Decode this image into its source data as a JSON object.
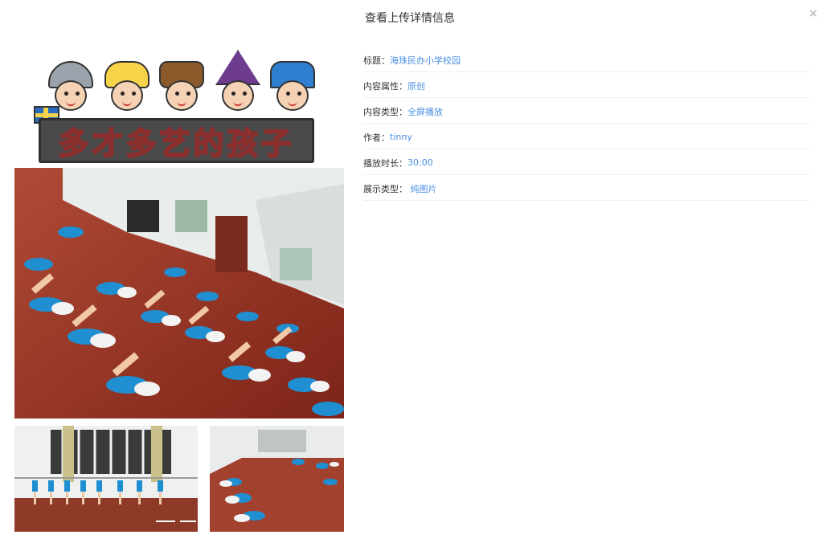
{
  "dialog": {
    "title": "查看上传详情信息",
    "close_glyph": "×"
  },
  "banner": {
    "text": "多才多艺的孩子"
  },
  "details": [
    {
      "key": "标题：",
      "value": "海珠民办小学校园"
    },
    {
      "key": "内容属性：",
      "value": "原创"
    },
    {
      "key": "内容类型：",
      "value": "全屏播放"
    },
    {
      "key": "作者：",
      "value": "tinny"
    },
    {
      "key": "播放时长：",
      "value": "30:00"
    },
    {
      "key": "展示类型： ",
      "value": "纯图片"
    }
  ],
  "colors": {
    "link": "#4a90e2",
    "floor": "#8e2f22",
    "uniform_blue": "#1f8fd1"
  },
  "icons": {
    "close": "close-icon"
  }
}
